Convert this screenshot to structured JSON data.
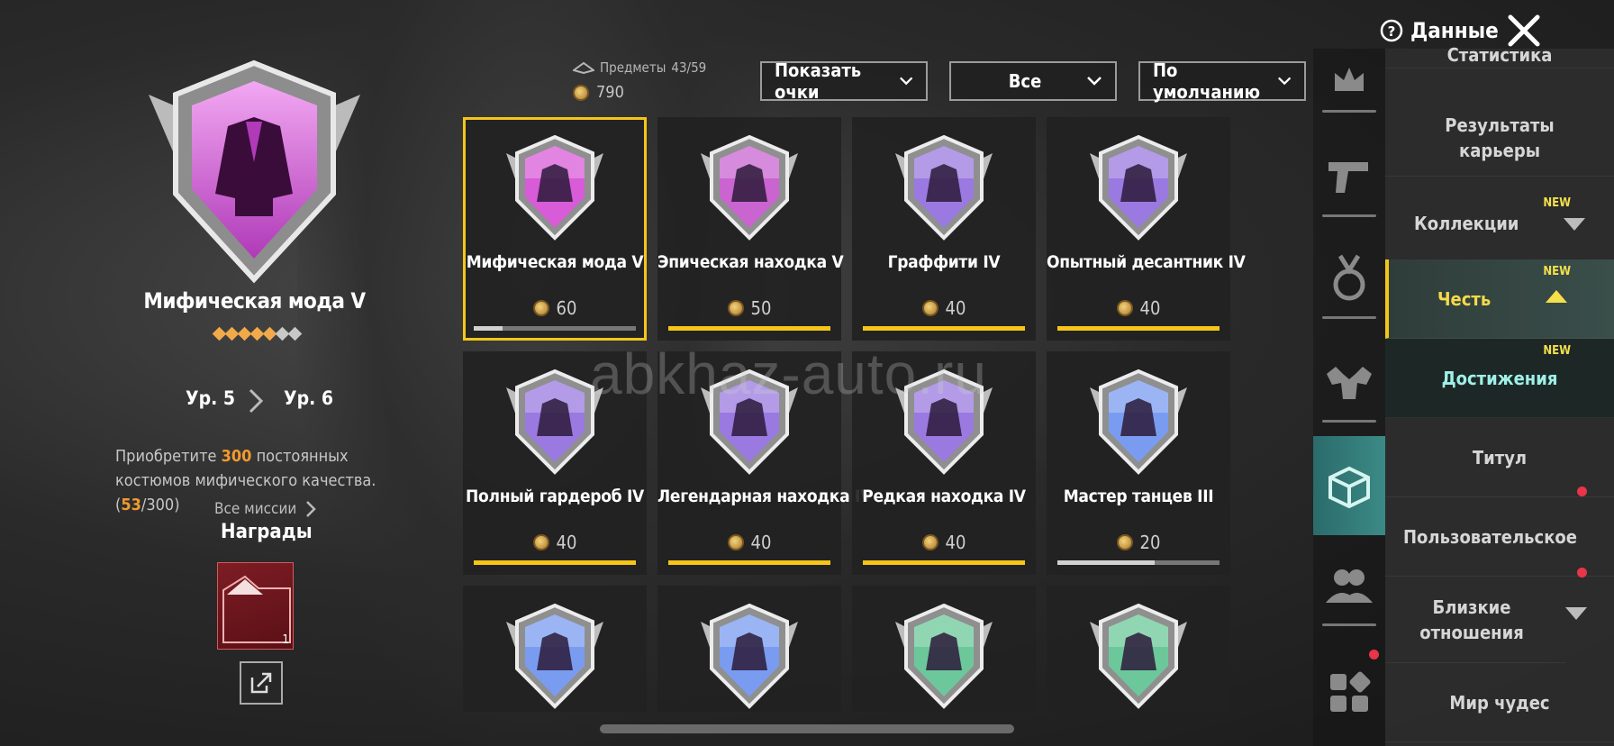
{
  "header": {
    "data_label": "Данные",
    "close": "close"
  },
  "left_panel": {
    "title": "Мифическая мода V",
    "stars_on": 5,
    "stars_total": 7,
    "level_from": "Ур. 5",
    "level_to": "Ур. 6",
    "mission_pre": "Приобретите ",
    "mission_num": "300",
    "mission_mid": " постоянных костюмов мифического качества. (",
    "mission_progress": "53",
    "mission_total": "/300)",
    "all_missions": "Все миссии",
    "rewards_title": "Награды",
    "reward_count": "1"
  },
  "toolbar": {
    "items_label": "Предметы",
    "items_value": "43/59",
    "points": "790",
    "dropdowns": [
      "Показать очки",
      "Все",
      "По умолчанию"
    ]
  },
  "cards": [
    {
      "name": "Мифическая мода V",
      "points": "60",
      "progress": 0.18,
      "color": "#d85bd8",
      "icon": "jacket-icon",
      "selected": true
    },
    {
      "name": "Эпическая находка V",
      "points": "50",
      "progress": 1.0,
      "color": "#c964d0",
      "icon": "coat-icon"
    },
    {
      "name": "Граффити IV",
      "points": "40",
      "progress": 1.0,
      "color": "#9a7ae0",
      "icon": "graffiti-icon"
    },
    {
      "name": "Опытный десантник IV",
      "points": "40",
      "progress": 1.0,
      "color": "#9a7ae0",
      "icon": "parachute-icon"
    },
    {
      "name": "Полный гардероб IV",
      "points": "40",
      "progress": 1.0,
      "color": "#9a7ae0",
      "icon": "wardrobe-icon"
    },
    {
      "name": "Легендарная находка IV",
      "points": "40",
      "progress": 1.0,
      "color": "#9a7ae0",
      "icon": "suit-icon"
    },
    {
      "name": "Редкая находка IV",
      "points": "40",
      "progress": 1.0,
      "color": "#9a7ae0",
      "icon": "robe-icon"
    },
    {
      "name": "Мастер танцев III",
      "points": "20",
      "progress": 0.6,
      "color": "#7a9cf0",
      "icon": "dancer-icon"
    },
    {
      "name": "",
      "points": "",
      "progress": null,
      "color": "#7a9cf0",
      "icon": "eagle-icon"
    },
    {
      "name": "",
      "points": "",
      "progress": null,
      "color": "#7a9cf0",
      "icon": "rifle-icon"
    },
    {
      "name": "",
      "points": "",
      "progress": null,
      "color": "#6cc89a",
      "icon": "dancer-music-icon"
    },
    {
      "name": "",
      "points": "",
      "progress": null,
      "color": "#6cc89a",
      "icon": "victory-icon"
    }
  ],
  "watermark": "abkhaz-auto.ru",
  "side_icons": [
    "crown-icon",
    "pistol-icon",
    "medal-icon",
    "muscle-icon",
    "box-icon",
    "friends-icon",
    "apps-icon"
  ],
  "menu": {
    "items": [
      {
        "label": "Статистика"
      },
      {
        "label": "Результаты карьеры"
      },
      {
        "label": "Коллекции",
        "new": "NEW"
      },
      {
        "label": "Честь",
        "new": "NEW"
      },
      {
        "label": "Достижения",
        "new": "NEW"
      },
      {
        "label": "Титул"
      },
      {
        "label": "Пользовательское"
      },
      {
        "label": "Близкие отношения"
      },
      {
        "label": "Мир чудес"
      }
    ]
  },
  "colors": {
    "accent_yellow": "#f5c518",
    "active_teal": "#3b8a86",
    "mythic_pink": "#d85bd8"
  }
}
